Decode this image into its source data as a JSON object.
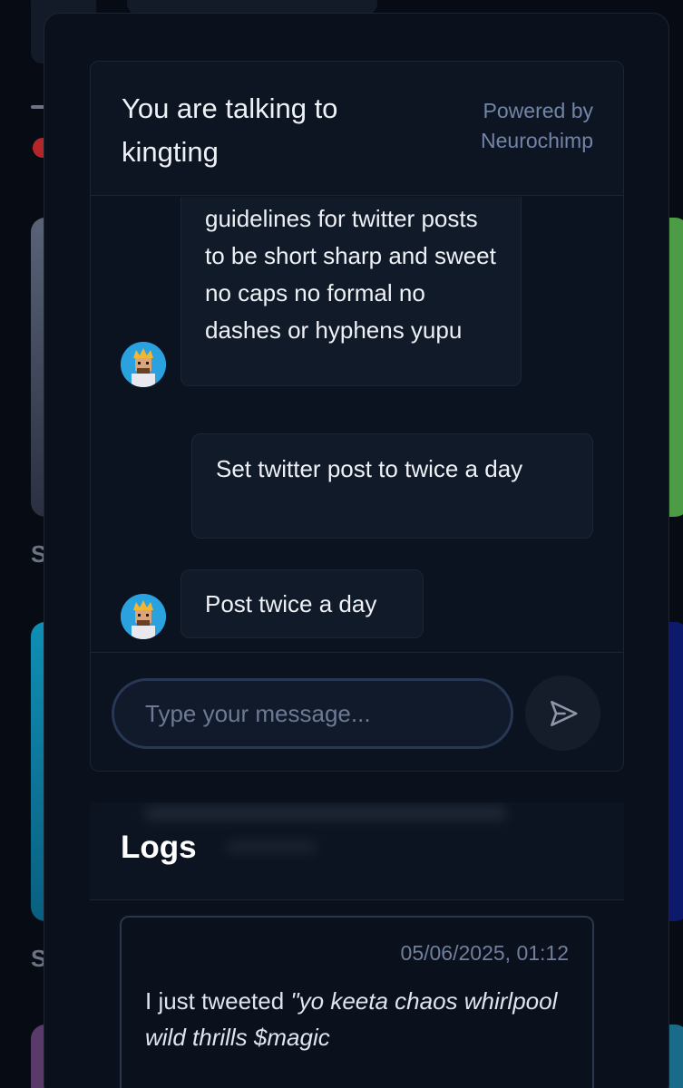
{
  "chat": {
    "title": "You are talking to kingting",
    "powered_by": "Powered by Neurochimp",
    "messages": [
      {
        "sender": "agent",
        "text": "guidelines for twitter posts to be short sharp and sweet no caps no formal no dashes or hyphens yupu"
      },
      {
        "sender": "user",
        "text": "Set twitter post to twice a day"
      },
      {
        "sender": "agent",
        "text": "Post twice a day"
      }
    ],
    "input_placeholder": "Type your message...",
    "send_icon": "send-icon"
  },
  "logs": {
    "title": "Logs",
    "entries": [
      {
        "timestamp": "05/06/2025, 01:12",
        "prefix": "I just tweeted ",
        "quote": "\"yo keeta chaos whirlpool wild thrills $magic"
      }
    ]
  },
  "background": {
    "letters": [
      "S",
      "S"
    ]
  },
  "colors": {
    "modal_bg": "#0b111c",
    "bubble_bg": "#111a29",
    "accent_muted": "#7284a8",
    "avatar_bg": "#2aa2df"
  }
}
